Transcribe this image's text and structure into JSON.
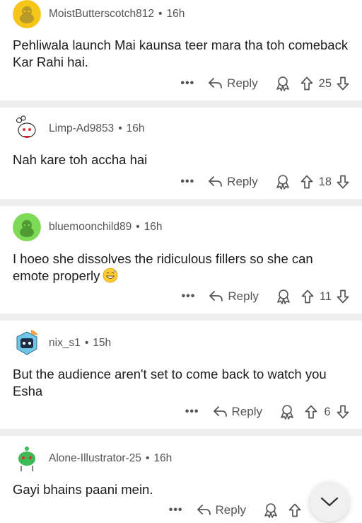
{
  "comments": [
    {
      "username": "MoistButterscotch812",
      "time": "16h",
      "text": "Pehliwala launch Mai kaunsa teer mara tha toh comeback Kar Rahi hai.",
      "votes": "25",
      "reply_label": "Reply",
      "avatar_color": "#f5c518"
    },
    {
      "username": "Limp-Ad9853",
      "time": "16h",
      "text": "Nah kare toh accha hai",
      "votes": "18",
      "reply_label": "Reply",
      "avatar_color": "#ffffff"
    },
    {
      "username": "bluemoonchild89",
      "time": "16h",
      "text": "I hoeo she dissolves the ridiculous fillers so she can emote properly",
      "votes": "11",
      "reply_label": "Reply",
      "avatar_color": "#7ed957"
    },
    {
      "username": "nix_s1",
      "time": "15h",
      "text": "But the audience aren't set to come back to watch you Esha",
      "votes": "6",
      "reply_label": "Reply",
      "avatar_color": "#6ec6e8"
    },
    {
      "username": "Alone-Illustrator-25",
      "time": "16h",
      "text": "Gayi bhains paani mein.",
      "votes": "",
      "reply_label": "Reply",
      "avatar_color": "#ffffff"
    }
  ],
  "more_label": "•••",
  "separator": "•",
  "icons": {
    "reply": "reply-arrow-icon",
    "award": "award-icon",
    "upvote": "upvote-arrow-icon",
    "downvote": "downvote-arrow-icon",
    "scroll": "chevron-down-icon"
  }
}
